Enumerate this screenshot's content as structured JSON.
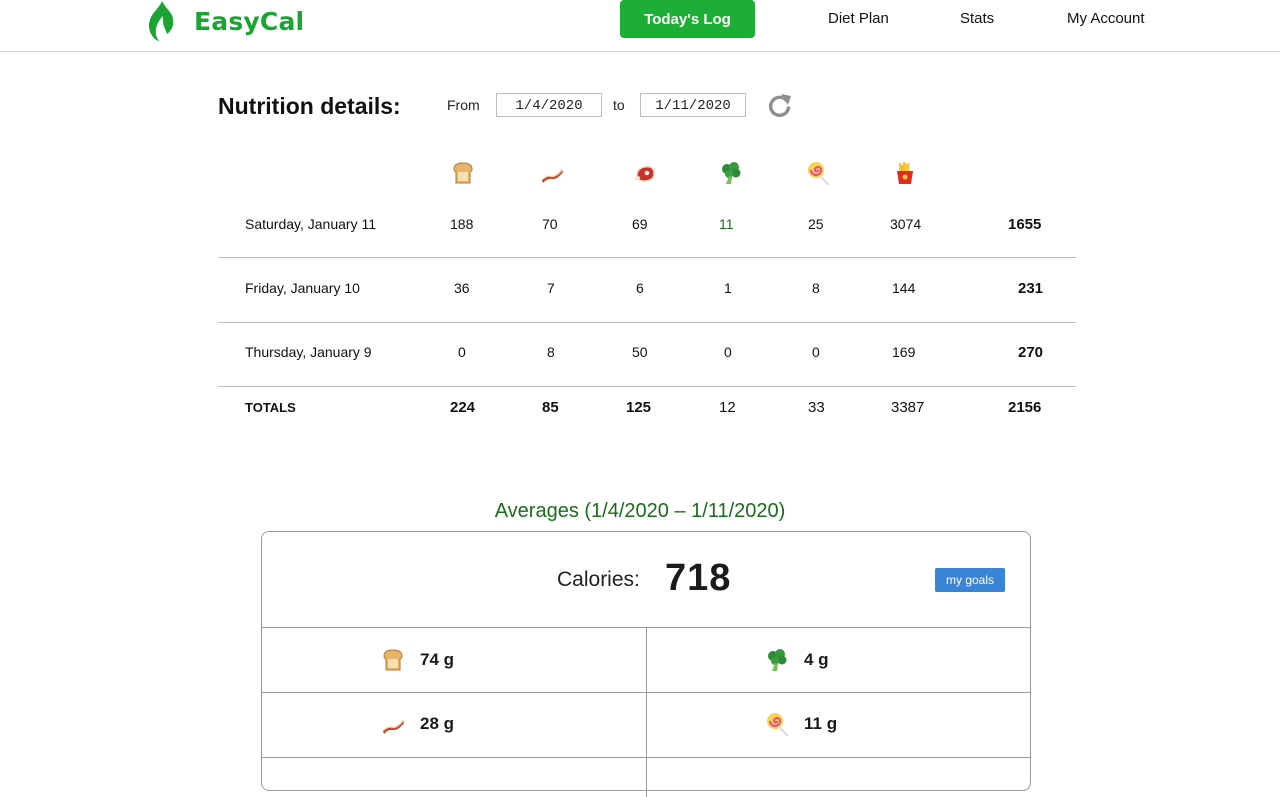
{
  "app": {
    "name": "EasyCal",
    "brand_color": "#1aa431"
  },
  "nav": {
    "active": "Today's Log",
    "links": [
      "Diet Plan",
      "Stats",
      "My Account"
    ]
  },
  "nutrition": {
    "title": "Nutrition details:",
    "from_label": "From",
    "from_value": "1/4/2020",
    "to_label": "to",
    "to_value": "1/11/2020",
    "refresh_icon": "refresh-icon",
    "columns_icons": [
      "bread-icon",
      "bacon-icon",
      "meat-icon",
      "broccoli-icon",
      "lollipop-icon",
      "fries-icon"
    ],
    "rows": [
      {
        "date": "Saturday, January 11",
        "values": [
          "188",
          "70",
          "69",
          "11",
          "25",
          "3074"
        ],
        "total": "1655"
      },
      {
        "date": "Friday, January 10",
        "values": [
          "36",
          "7",
          "6",
          "1",
          "8",
          "144"
        ],
        "total": "231"
      },
      {
        "date": "Thursday, January 9",
        "values": [
          "0",
          "8",
          "50",
          "0",
          "0",
          "169"
        ],
        "total": "270"
      }
    ],
    "totals": {
      "label": "TOTALS",
      "values": [
        "224",
        "85",
        "125",
        "12",
        "33",
        "3387"
      ],
      "total": "2156"
    }
  },
  "averages": {
    "title": "Averages (1/4/2020 – 1/11/2020)",
    "calories_label": "Calories:",
    "calories_value": "718",
    "goals_button": "my goals",
    "macros": [
      {
        "icon": "bread-icon",
        "value": "74 g"
      },
      {
        "icon": "broccoli-icon",
        "value": "4 g"
      },
      {
        "icon": "bacon-icon",
        "value": "28 g"
      },
      {
        "icon": "lollipop-icon",
        "value": "11 g"
      }
    ]
  }
}
